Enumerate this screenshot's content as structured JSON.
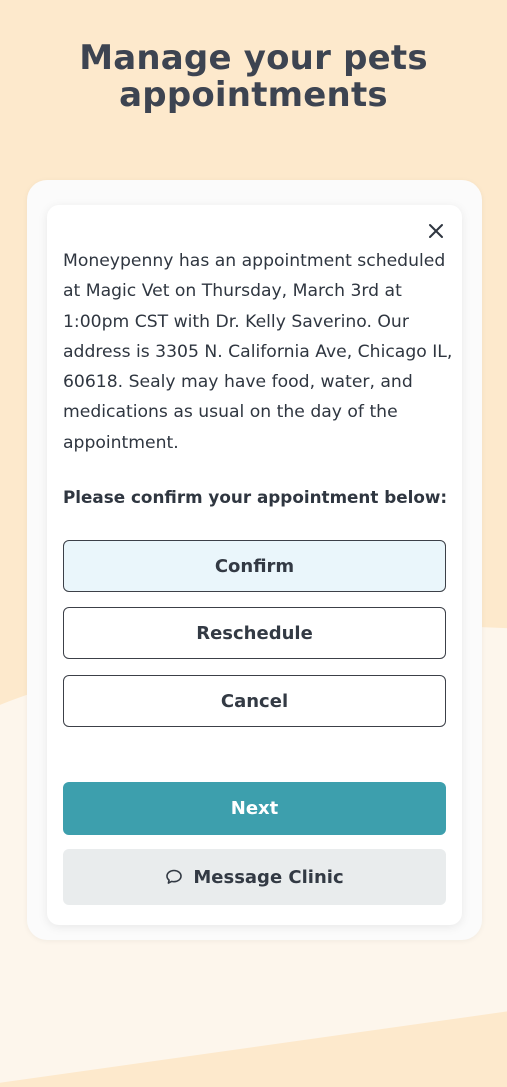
{
  "header": {
    "title_line1": "Manage your pets",
    "title_line2": "appointments"
  },
  "modal": {
    "close_icon": "close-icon",
    "message": "Moneypenny has an appointment scheduled at Magic Vet on Thursday, March 3rd at 1:00pm CST with Dr. Kelly Saverino. Our address is 3305 N. California Ave, Chicago IL, 60618. Sealy may have food, water, and medications as usual on the day of the appointment.",
    "prompt": "Please confirm your appointment below:",
    "options": [
      {
        "label": "Confirm",
        "selected": true
      },
      {
        "label": "Reschedule",
        "selected": false
      },
      {
        "label": "Cancel",
        "selected": false
      }
    ],
    "next_label": "Next",
    "message_clinic_label": "Message Clinic",
    "message_clinic_icon": "chat-bubble-icon"
  },
  "colors": {
    "background": "#fde9cc",
    "primary": "#3d9fad",
    "selected_fill": "#eaf6fb",
    "text": "#2f3640"
  }
}
